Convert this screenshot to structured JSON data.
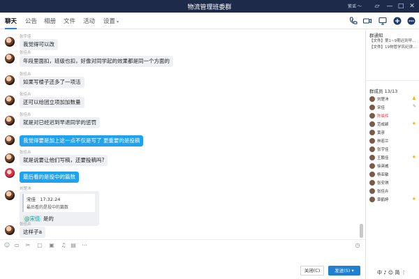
{
  "window": {
    "title": "物流管理班委群",
    "user": "紫谣 ～"
  },
  "tabs": [
    {
      "label": "聊天",
      "active": true
    },
    {
      "label": "公告"
    },
    {
      "label": "相册"
    },
    {
      "label": "文件"
    },
    {
      "label": "活动"
    },
    {
      "label": "设置"
    }
  ],
  "messages": [
    {
      "name": "张宇佳",
      "text": "我觉得可以改"
    },
    {
      "name": "张佳卉",
      "text": "年段里面扣，班级也扣，好像对同学起的效果都是同一个方面的"
    },
    {
      "name": "张佳卉",
      "text": "如果写楼子还多了一项活"
    },
    {
      "name": "张佳卉",
      "text": "还可以给团立项加加数量"
    },
    {
      "name": "张佳卉",
      "text": "就是对已经迟到早退同学的惩罚"
    },
    {
      "name": "",
      "text": "我觉得要是加上这一点不仅是写了 更重要的是投稿"
    },
    {
      "name": "张佳卉",
      "text": "就是说要让他们写稿，还要投稿吗?"
    },
    {
      "name": "",
      "text": "最后看的是投中的篇数"
    },
    {
      "name": "刘楚沛",
      "quote_author": "宋佳",
      "quote_time": "17:32:24",
      "quote_text": "最后看的是投中的篇数",
      "mention": "@宋佳",
      "reply": "是的"
    },
    {
      "name": "张佳卉",
      "text": "这样子a"
    }
  ],
  "actions": {
    "close_label": "关闭(C)",
    "send_label": "发送(S)"
  },
  "announcement": {
    "title": "群通知",
    "items": [
      {
        "tag": "【文件】",
        "text": "第1~9期迟到早..."
      },
      {
        "tag": "【文件】",
        "text": "19物管学风纪律..."
      }
    ]
  },
  "members": {
    "title": "群成员 13/13",
    "list": [
      {
        "name": "刘楚沛",
        "badge": "owner"
      },
      {
        "name": "宋佳",
        "badge": "edit"
      },
      {
        "name": "陈晨辉",
        "red": true
      },
      {
        "name": "范成颖",
        "badge": "admin"
      },
      {
        "name": "黄彦"
      },
      {
        "name": "林若兰"
      },
      {
        "name": "张宇佳"
      },
      {
        "name": "王鹏佳",
        "badge": "admin"
      },
      {
        "name": "徐英威"
      },
      {
        "name": "杨亚敏"
      },
      {
        "name": "张安琪"
      },
      {
        "name": "张佳卉"
      },
      {
        "name": "章鹤婷",
        "badge": "admin"
      }
    ]
  },
  "ime_text": "中 ♪ ☺ 简 ⋮",
  "colors": {
    "titlebar": "#1e2a4a",
    "accent": "#1f8ad8",
    "my_bubble": "#1fa3f0",
    "other_bubble": "#eef0f3",
    "send_button": "#1f7fd0"
  }
}
